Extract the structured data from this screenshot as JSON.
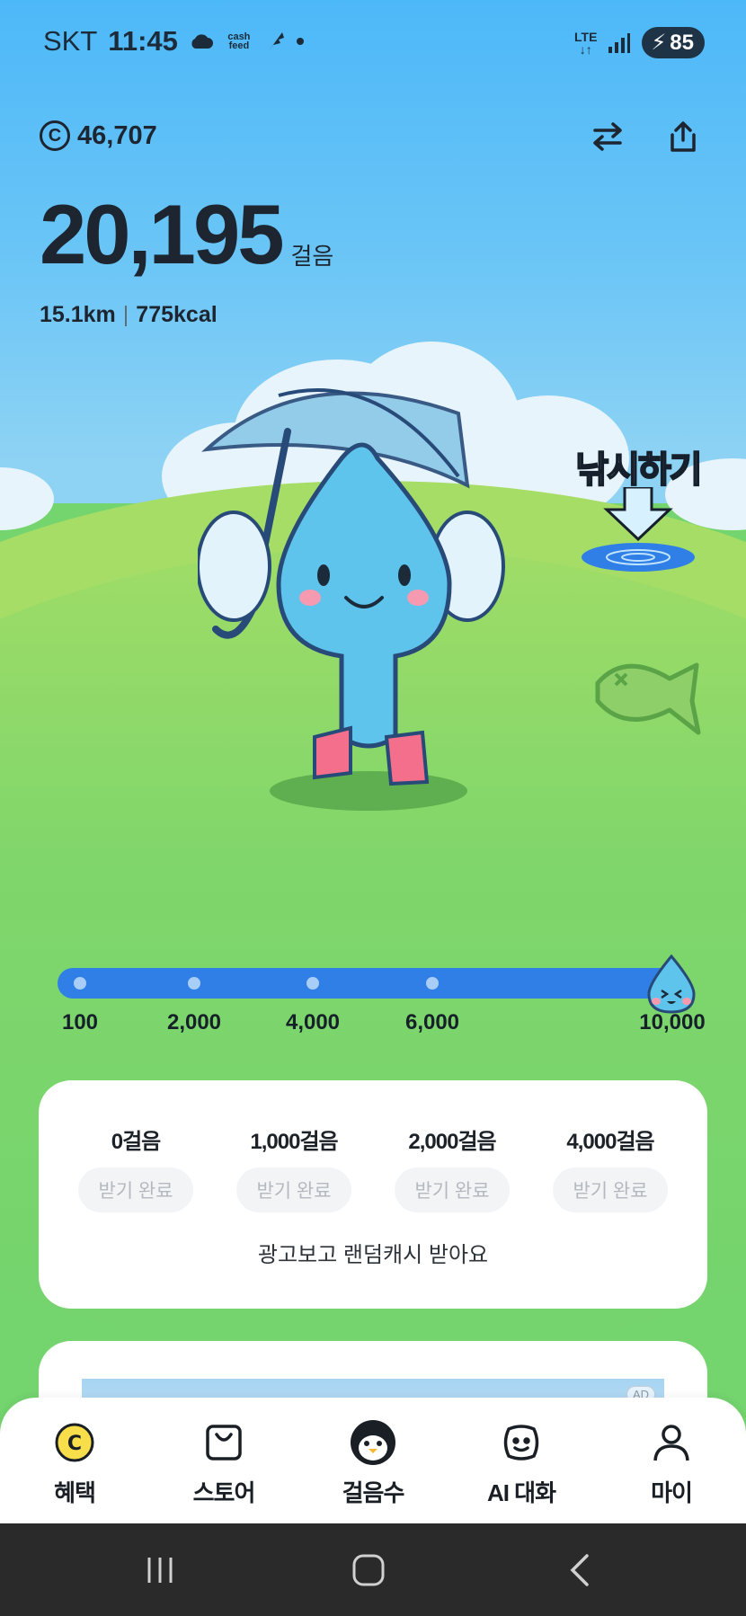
{
  "status_bar": {
    "carrier": "SKT",
    "time": "11:45",
    "cashfeed": "cash feed",
    "network": "LTE",
    "battery": "85"
  },
  "header": {
    "points": "46,707"
  },
  "steps": {
    "count": "20,195",
    "unit": "걸음",
    "distance": "15.1km",
    "separator": "|",
    "calories": "775kcal"
  },
  "fishing": {
    "title": "낚시하기"
  },
  "progress": {
    "milestones": [
      "100",
      "2,000",
      "4,000",
      "6,000",
      "10,000"
    ],
    "fill_fraction": 1.0
  },
  "rewards": {
    "items": [
      {
        "label": "0걸음",
        "button": "받기 완료"
      },
      {
        "label": "1,000걸음",
        "button": "받기 완료"
      },
      {
        "label": "2,000걸음",
        "button": "받기 완료"
      },
      {
        "label": "4,000걸음",
        "button": "받기 완료"
      }
    ],
    "footer": "광고보고 랜덤캐시 받아요"
  },
  "ad": {
    "tag": "AD"
  },
  "bottom_nav": {
    "items": [
      {
        "label": "혜택",
        "icon": "coin-icon"
      },
      {
        "label": "스토어",
        "icon": "shopping-bag-icon"
      },
      {
        "label": "걸음수",
        "icon": "penguin-icon"
      },
      {
        "label": "AI 대화",
        "icon": "smile-chat-icon"
      },
      {
        "label": "마이",
        "icon": "person-icon"
      }
    ]
  },
  "colors": {
    "progress_blue": "#2f7fe6",
    "sky": "#4db8f8",
    "grass": "#74d46e",
    "coin_yellow": "#f7de4a"
  }
}
